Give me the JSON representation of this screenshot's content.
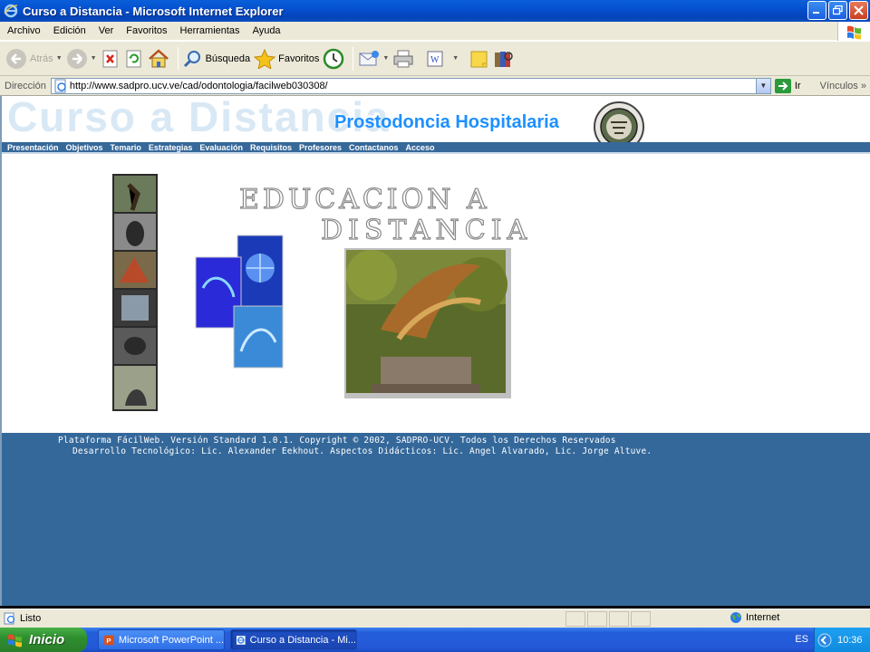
{
  "window": {
    "title": "Curso a Distancia - Microsoft Internet Explorer"
  },
  "menubar": {
    "items": [
      "Archivo",
      "Edición",
      "Ver",
      "Favoritos",
      "Herramientas",
      "Ayuda"
    ]
  },
  "toolbar": {
    "back_label": "Atrás",
    "search_label": "Búsqueda",
    "favorites_label": "Favoritos"
  },
  "address": {
    "label": "Dirección",
    "url": "http://www.sadpro.ucv.ve/cad/odontologia/facilweb030308/",
    "go_label": "Ir",
    "links_label": "Vínculos"
  },
  "page": {
    "header_watermark": "Curso a Distancia",
    "header_title": "Prostodoncia Hospitalaria",
    "nav": [
      "Presentación",
      "Objetivos",
      "Temario",
      "Estrategias",
      "Evaluación",
      "Requisitos",
      "Profesores",
      "Contactanos",
      "Acceso"
    ],
    "heading_line1": "EDUCACION  A",
    "heading_line2": "DISTANCIA",
    "footer_line1": "Plataforma FácilWeb. Versión Standard 1.0.1. Copyright © 2002, SADPRO-UCV. Todos los Derechos Reservados",
    "footer_line2": "Desarrollo Tecnológico: Lic. Alexander Eekhout. Aspectos Didácticos: Lic. Angel Alvarado, Lic. Jorge Altuve.",
    "colors": {
      "nav_bg": "#36689a",
      "footer_bg": "#34689a",
      "title_blue": "#1e90ff"
    }
  },
  "statusbar": {
    "status": "Listo",
    "zone": "Internet"
  },
  "taskbar": {
    "start_label": "Inicio",
    "tasks": [
      "Microsoft PowerPoint ...",
      "Curso a Distancia - Mi..."
    ],
    "language": "ES",
    "clock": "10:36"
  }
}
